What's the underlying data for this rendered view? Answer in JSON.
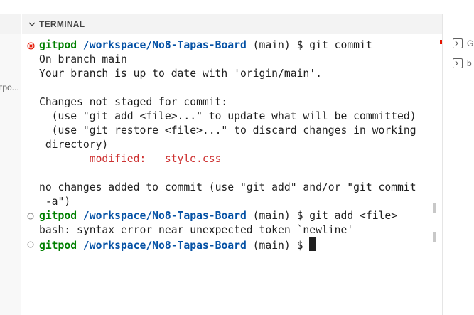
{
  "panel": {
    "title": "TERMINAL"
  },
  "sidebar_left": {
    "truncated_label": "tpo..."
  },
  "terminal": {
    "prompt_user": "gitpod",
    "prompt_path": "/workspace/No8-Tapas-Board",
    "prompt_suffix": " (main) $ ",
    "commands": [
      "git commit",
      "git add <file>",
      ""
    ],
    "output": {
      "l1": "On branch main",
      "l2": "Your branch is up to date with 'origin/main'.",
      "l3": "Changes not staged for commit:",
      "l4": "  (use \"git add <file>...\" to update what will be committed)",
      "l5": "  (use \"git restore <file>...\" to discard changes in working",
      "l6": " directory)",
      "l7_label": "        modified:   ",
      "l7_file": "style.css",
      "l8": "no changes added to commit (use \"git add\" and/or \"git commit",
      "l9": " -a\")",
      "l10": "bash: syntax error near unexpected token `newline'"
    },
    "colors": {
      "prompt_user": "#008000",
      "prompt_path": "#0451a5",
      "modified": "#cd3131",
      "error_decoration": "#e51400"
    }
  },
  "tabs_right": [
    {
      "label": "G",
      "icon": "terminal-icon"
    },
    {
      "label": "b",
      "icon": "terminal-icon"
    }
  ]
}
